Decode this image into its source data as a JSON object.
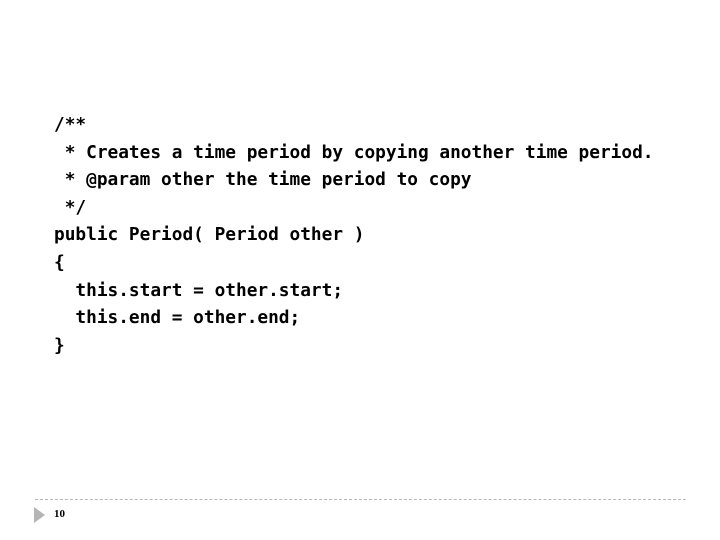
{
  "slide": {
    "code_lines": [
      "/**",
      " * Creates a time period by copying another time period.",
      " * @param other the time period to copy",
      " */",
      "public Period( Period other )",
      "{",
      "  this.start = other.start;",
      "  this.end = other.end;",
      "}"
    ],
    "slide_number": "10"
  },
  "footer": {
    "arrow_icon": "triangle-right-icon",
    "arrow_color": "#b5b5b5",
    "rule_color": "#b8b8b8"
  }
}
